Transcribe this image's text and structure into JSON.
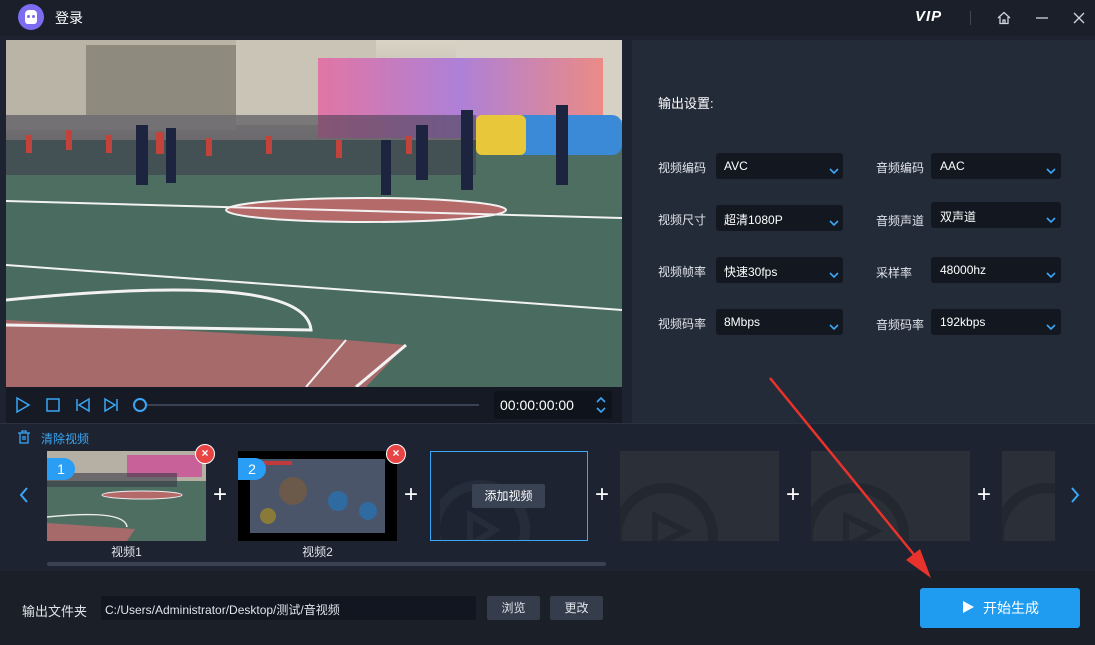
{
  "app": {
    "title": "登录",
    "vip": "VIP"
  },
  "player": {
    "time": "00:00:00:00",
    "progress": 0
  },
  "settings": {
    "title": "输出设置:",
    "fields": [
      {
        "label": "视频编码",
        "value": "AVC"
      },
      {
        "label": "音频编码",
        "value": "AAC"
      },
      {
        "label": "视频尺寸",
        "value": "超清1080P"
      },
      {
        "label": "音频声道",
        "value": "双声道"
      },
      {
        "label": "视频帧率",
        "value": "快速30fps"
      },
      {
        "label": "采样率",
        "value": "48000hz"
      },
      {
        "label": "视频码率",
        "value": "8Mbps"
      },
      {
        "label": "音频码率",
        "value": "192kbps"
      }
    ]
  },
  "strip": {
    "clear_label": "清除视频",
    "clips": [
      {
        "index": "1",
        "label": "视频1"
      },
      {
        "index": "2",
        "label": "视频2"
      }
    ],
    "add_label": "添加视频",
    "plus": "+",
    "delete": "×"
  },
  "output": {
    "label": "输出文件夹",
    "path": "C:/Users/Administrator/Desktop/测试/音视频",
    "browse": "浏览",
    "change": "更改",
    "start": "开始生成"
  },
  "colors": {
    "accent": "#1f9cf0",
    "delete": "#e84444",
    "arrow": "#e8322c"
  },
  "icons": [
    "app-logo-icon",
    "home-icon",
    "minimize-icon",
    "close-icon",
    "play-icon",
    "stop-icon",
    "prev-frame-icon",
    "next-frame-icon",
    "trash-icon",
    "chevron-left-icon",
    "chevron-right-icon",
    "play-triangle-icon"
  ]
}
